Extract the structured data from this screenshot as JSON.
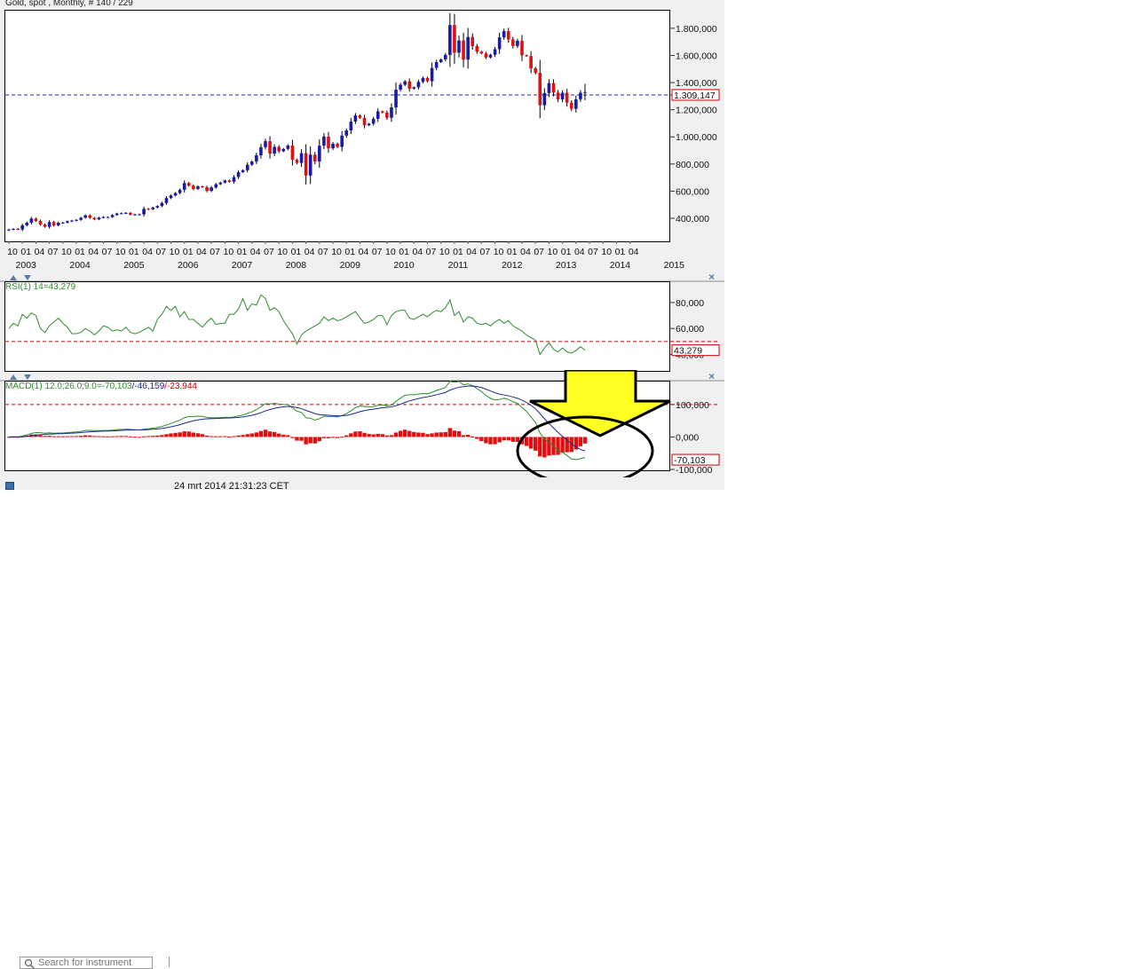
{
  "chart_title": "Gold, spot , Monthly, # 140 / 229",
  "rsi_label": "RSI(1) 14=43,279",
  "macd_label_prefix": "MACD(1) 12.0;26.0;9.0=",
  "macd_label_values": {
    "macd": "-70,103",
    "signal": "/-46,159",
    "hist": "/-23,944"
  },
  "status": {
    "search_placeholder": "Search for instrument",
    "timestamp": "24 mrt 2014 21:31:23 CET"
  },
  "colors": {
    "up": "#1a1aa8",
    "down": "#e01010",
    "rsi": "#2e8b2e",
    "macd": "#1a2b8a",
    "signal": "#2e8b2e",
    "hist": "#e01010",
    "ref": "#cc0000",
    "arrow": "#ffff22"
  },
  "chart_data": [
    {
      "type": "candlestick",
      "title": "Gold, spot , Monthly, # 140 / 229",
      "x_tick_labels": [
        "10",
        "01",
        "04",
        "07",
        "10",
        "01",
        "04",
        "07",
        "10",
        "01",
        "04",
        "07",
        "10",
        "01",
        "04",
        "07",
        "10",
        "01",
        "04",
        "07",
        "10",
        "01",
        "04",
        "07",
        "10",
        "01",
        "04",
        "07",
        "10",
        "01",
        "04",
        "07",
        "10",
        "01",
        "04",
        "07",
        "10",
        "01",
        "04",
        "07",
        "10",
        "01",
        "04",
        "07",
        "10",
        "01",
        "04"
      ],
      "x_year_labels": [
        "2003",
        "2004",
        "2005",
        "2006",
        "2007",
        "2008",
        "2009",
        "2010",
        "2011",
        "2012",
        "2013",
        "2014",
        "2015"
      ],
      "y_tick_labels": [
        "1.800,000",
        "1.600,000",
        "1.400,000",
        "1.200,000",
        "1.000,000",
        "800,000",
        "600,000",
        "400,000"
      ],
      "ylim": [
        230,
        1930
      ],
      "last_price": 1309.147,
      "last_price_label": "1.309,147",
      "first_month": "2002-10",
      "closes": [
        317,
        322,
        318,
        348,
        368,
        398,
        380,
        355,
        337,
        372,
        348,
        367,
        368,
        378,
        383,
        388,
        404,
        422,
        403,
        392,
        405,
        409,
        409,
        424,
        435,
        437,
        440,
        427,
        428,
        429,
        470,
        466,
        479,
        490,
        513,
        549,
        568,
        586,
        610,
        660,
        640,
        616,
        635,
        629,
        602,
        627,
        651,
        663,
        679,
        669,
        704,
        740,
        754,
        795,
        818,
        864,
        924,
        968,
        877,
        926,
        894,
        911,
        936,
        831,
        808,
        880,
        715,
        869,
        819,
        935,
        1002,
        916,
        949,
        926,
        1009,
        1047,
        1113,
        1158,
        1140,
        1085,
        1097,
        1133,
        1188,
        1179,
        1141,
        1217,
        1348,
        1384,
        1409,
        1355,
        1365,
        1405,
        1434,
        1410,
        1508,
        1551,
        1570,
        1604,
        1824,
        1620,
        1710,
        1569,
        1736,
        1669,
        1628,
        1615,
        1585,
        1605,
        1646,
        1733,
        1779,
        1718,
        1670,
        1708,
        1601,
        1595,
        1504,
        1472,
        1233,
        1323,
        1396,
        1326,
        1276,
        1325,
        1252,
        1207,
        1277,
        1325,
        1330
      ],
      "current_open": 1280,
      "current_high": 1390,
      "current_low": 1270
    },
    {
      "type": "line",
      "title": "RSI(1) 14=43,279",
      "y_tick_labels": [
        "80,000",
        "60,000",
        "40,000"
      ],
      "ylim": [
        28,
        95
      ],
      "reference_line": 50,
      "last_value": 43.279,
      "last_value_label": "43,279",
      "values": [
        60,
        64,
        62,
        71,
        68,
        72,
        70,
        60,
        57,
        62,
        65,
        68,
        64,
        61,
        56,
        56,
        57,
        60,
        58,
        55,
        58,
        62,
        61,
        58,
        59,
        58,
        61,
        57,
        56,
        57,
        59,
        61,
        58,
        67,
        71,
        77,
        74,
        77,
        69,
        73,
        67,
        67,
        64,
        61,
        65,
        68,
        63,
        64,
        64,
        71,
        71,
        75,
        83,
        74,
        79,
        78,
        86,
        83,
        74,
        76,
        73,
        66,
        61,
        56,
        48,
        55,
        58,
        60,
        62,
        64,
        69,
        66,
        68,
        66,
        67,
        69,
        71,
        73,
        68,
        64,
        65,
        67,
        70,
        70,
        63,
        70,
        73,
        74,
        74,
        68,
        67,
        69,
        71,
        69,
        72,
        74,
        73,
        76,
        82,
        70,
        73,
        65,
        69,
        68,
        64,
        63,
        64,
        62,
        65,
        67,
        64,
        66,
        62,
        60,
        58,
        55,
        53,
        51,
        40,
        45,
        49,
        44,
        42,
        45,
        42,
        41,
        43,
        46,
        43.279
      ]
    },
    {
      "type": "line",
      "title": "MACD(1) 12.0;26.0;9.0=-70,103/-46,159/-23,944",
      "y_tick_labels": [
        "100,000",
        "0,000",
        "-100,000"
      ],
      "ylim": [
        -100,
        168
      ],
      "reference_line": 100,
      "last_value_label": "-70,103",
      "macd_last": -70.103,
      "signal_last": -46.159,
      "histogram_last": -23.944
    }
  ]
}
